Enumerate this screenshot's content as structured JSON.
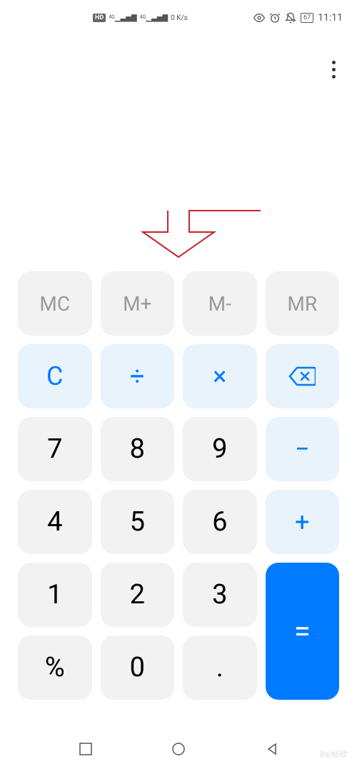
{
  "status_bar": {
    "hd": "HD",
    "signal1": "4G",
    "signal2": "4G",
    "speed": "0 K/s",
    "battery": "67",
    "time": "11:11"
  },
  "keys": {
    "mc": "MC",
    "mplus": "M+",
    "mminus": "M-",
    "mr": "MR",
    "clear": "C",
    "divide": "÷",
    "multiply": "×",
    "seven": "7",
    "eight": "8",
    "nine": "9",
    "minus": "−",
    "four": "4",
    "five": "5",
    "six": "6",
    "plus": "+",
    "one": "1",
    "two": "2",
    "three": "3",
    "equals": "=",
    "percent": "%",
    "zero": "0",
    "decimal": "."
  },
  "watermark": "Bai经验"
}
